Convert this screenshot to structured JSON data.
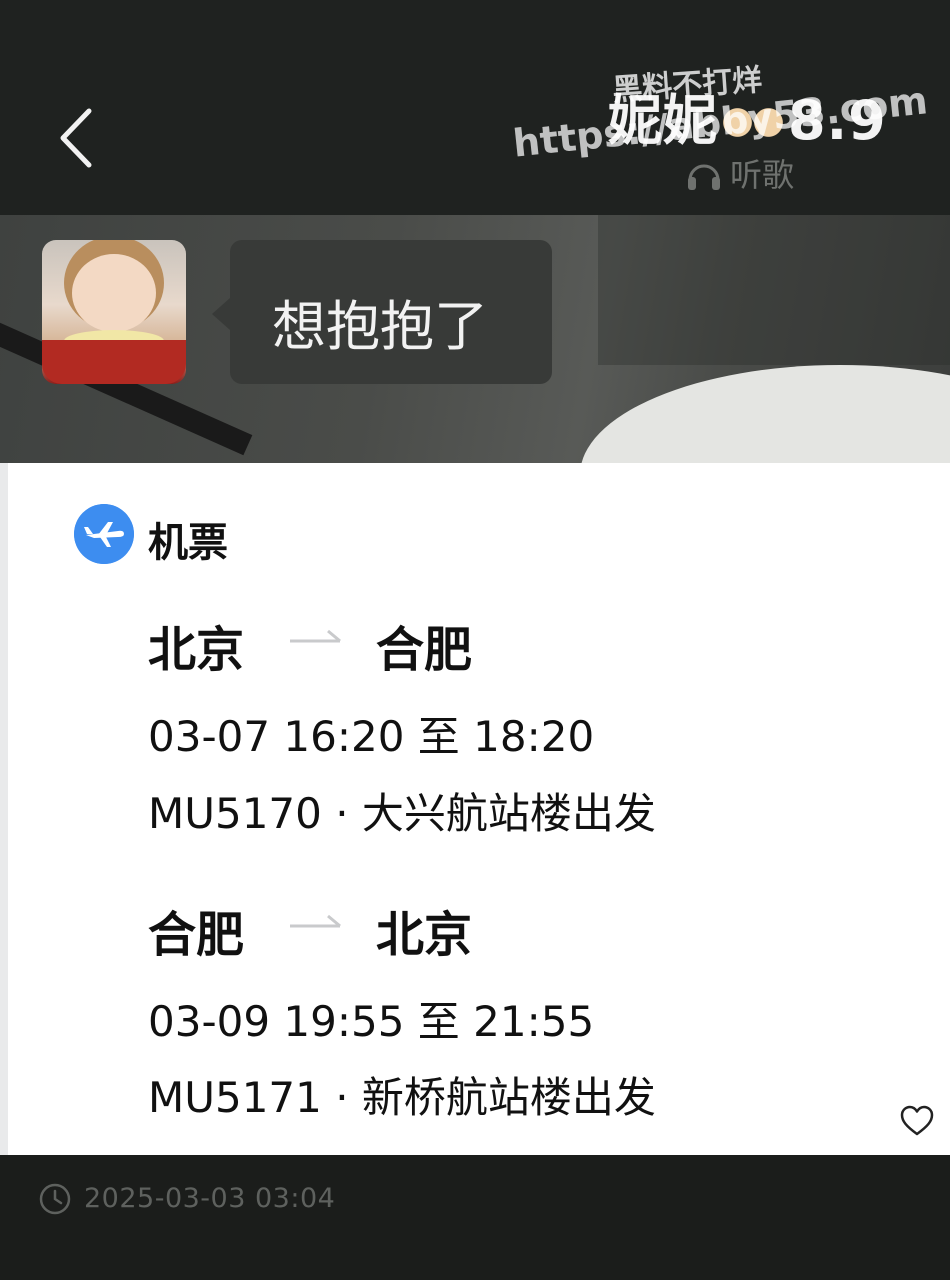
{
  "header": {
    "title": "妮妮",
    "title_suffix": "8.9",
    "listen_label": "听歌",
    "watermark_line1": "黑料不打烊",
    "watermark_line2": "https://abby53.com"
  },
  "message": {
    "text": "想抱抱了"
  },
  "ticket": {
    "label": "机票",
    "icon": "airplane-icon",
    "icon_color": "#3d8df0",
    "flights": [
      {
        "from": "北京",
        "to": "合肥",
        "times": "03-07 16:20 至 18:20",
        "flight": "MU5170 · 大兴航站楼出发"
      },
      {
        "from": "合肥",
        "to": "北京",
        "times": "03-09 19:55 至 21:55",
        "flight": "MU5171 · 新桥航站楼出发"
      }
    ]
  },
  "footer": {
    "timestamp": "2025-03-03 03:04"
  }
}
